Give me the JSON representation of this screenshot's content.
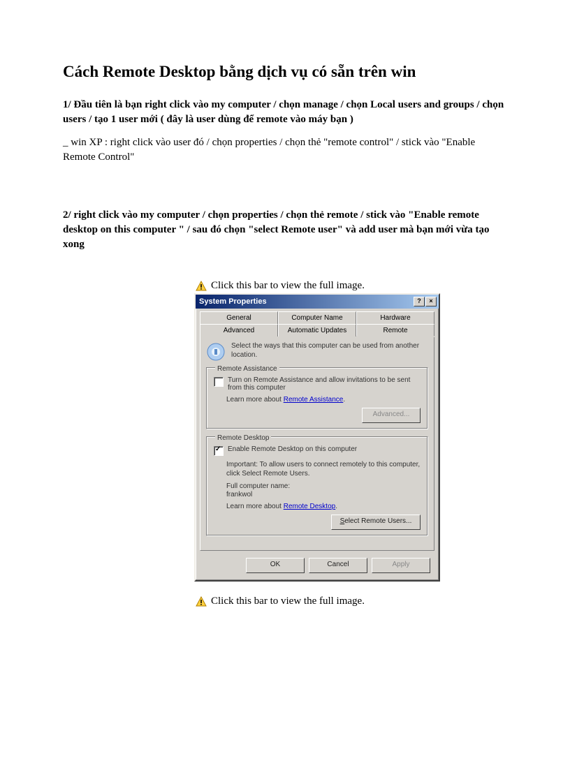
{
  "doc": {
    "title": "Cách Remote Desktop bằng dịch vụ có sẵn trên win",
    "para1": "1/ Đầu tiên là bạn right click vào my computer / chọn manage / chọn Local users and groups / chọn users / tạo 1 user mới ( đây là user dùng để remote vào máy bạn )",
    "para2": "_ win XP : right click vào user đó / chọn properties / chọn thẻ \"remote control\" / stick vào \"Enable Remote Control\"",
    "para3": "2/ right click vào my computer / chọn properties / chọn thẻ remote / stick vào \"Enable remote desktop on this computer \" / sau đó chọn \"select Remote user\" và add user mà bạn mới vừa tạo xong",
    "bar_text_top": "Click this bar to view the full image.",
    "bar_text_bottom": "Click this bar to view the full image."
  },
  "dialog": {
    "title": "System Properties",
    "help": "?",
    "close": "×",
    "tabs_row1": [
      "General",
      "Computer Name",
      "Hardware"
    ],
    "tabs_row2": [
      "Advanced",
      "Automatic Updates",
      "Remote"
    ],
    "info_text": "Select the ways that this computer can be used from another location.",
    "group1": {
      "legend": "Remote Assistance",
      "checkbox": "Turn on Remote Assistance and allow invitations to be sent from this computer",
      "learn_prefix": "Learn more about ",
      "learn_link": "Remote Assistance",
      "advanced_btn": "Advanced..."
    },
    "group2": {
      "legend": "Remote Desktop",
      "checkbox": "Enable Remote Desktop on this computer",
      "important": "Important: To allow users to connect remotely to this computer, click Select Remote Users.",
      "fullname_label": "Full computer name:",
      "fullname_value": "frankwol",
      "learn_prefix": "Learn more about ",
      "learn_link": "Remote Desktop",
      "select_btn_pre": "S",
      "select_btn": "elect Remote Users..."
    },
    "buttons": {
      "ok": "OK",
      "cancel": "Cancel",
      "apply": "Apply"
    }
  }
}
